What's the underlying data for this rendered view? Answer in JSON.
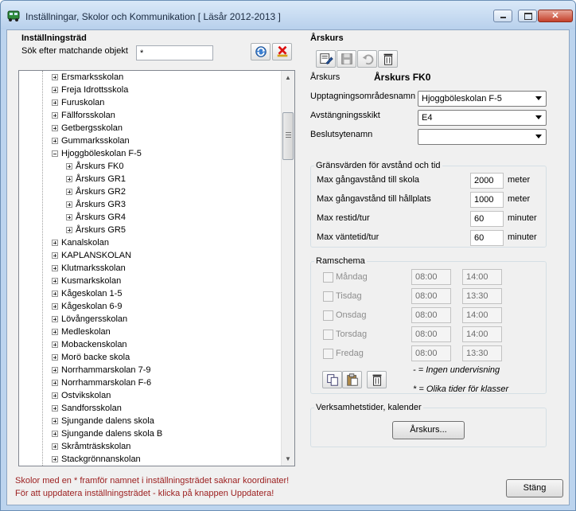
{
  "window": {
    "title": "Inställningar, Skolor och Kommunikation [ Läsår 2012-2013 ]"
  },
  "left": {
    "heading": "Inställningsträd",
    "search_label": "Sök efter matchande objekt",
    "search_value": "*",
    "tree_items": [
      {
        "label": "Ersmarksskolan",
        "level": 0,
        "exp": "plus"
      },
      {
        "label": "Freja Idrottsskola",
        "level": 0,
        "exp": "plus"
      },
      {
        "label": "Furuskolan",
        "level": 0,
        "exp": "plus"
      },
      {
        "label": "Fällforsskolan",
        "level": 0,
        "exp": "plus"
      },
      {
        "label": "Getbergsskolan",
        "level": 0,
        "exp": "plus"
      },
      {
        "label": "Gummarksskolan",
        "level": 0,
        "exp": "plus"
      },
      {
        "label": "Hjoggböleskolan F-5",
        "level": 0,
        "exp": "minus"
      },
      {
        "label": "Årskurs FK0",
        "level": 1,
        "exp": "plus"
      },
      {
        "label": "Årskurs GR1",
        "level": 1,
        "exp": "plus"
      },
      {
        "label": "Årskurs GR2",
        "level": 1,
        "exp": "plus"
      },
      {
        "label": "Årskurs GR3",
        "level": 1,
        "exp": "plus"
      },
      {
        "label": "Årskurs GR4",
        "level": 1,
        "exp": "plus"
      },
      {
        "label": "Årskurs GR5",
        "level": 1,
        "exp": "plus"
      },
      {
        "label": "Kanalskolan",
        "level": 0,
        "exp": "plus"
      },
      {
        "label": "KAPLANSKOLAN",
        "level": 0,
        "exp": "plus"
      },
      {
        "label": "Klutmarksskolan",
        "level": 0,
        "exp": "plus"
      },
      {
        "label": "Kusmarkskolan",
        "level": 0,
        "exp": "plus"
      },
      {
        "label": "Kågeskolan 1-5",
        "level": 0,
        "exp": "plus"
      },
      {
        "label": "Kågeskolan 6-9",
        "level": 0,
        "exp": "plus"
      },
      {
        "label": "Lövångersskolan",
        "level": 0,
        "exp": "plus"
      },
      {
        "label": "Medleskolan",
        "level": 0,
        "exp": "plus"
      },
      {
        "label": "Mobackenskolan",
        "level": 0,
        "exp": "plus"
      },
      {
        "label": "Morö backe skola",
        "level": 0,
        "exp": "plus"
      },
      {
        "label": "Norrhammarskolan 7-9",
        "level": 0,
        "exp": "plus"
      },
      {
        "label": "Norrhammarskolan F-6",
        "level": 0,
        "exp": "plus"
      },
      {
        "label": "Ostvikskolan",
        "level": 0,
        "exp": "plus"
      },
      {
        "label": "Sandforsskolan",
        "level": 0,
        "exp": "plus"
      },
      {
        "label": "Sjungande dalens skola",
        "level": 0,
        "exp": "plus"
      },
      {
        "label": "Sjungande dalens skola B",
        "level": 0,
        "exp": "plus"
      },
      {
        "label": "Skråmträskskolan",
        "level": 0,
        "exp": "plus"
      },
      {
        "label": "Stackgrönnanskolan",
        "level": 0,
        "exp": "plus"
      }
    ]
  },
  "right": {
    "heading": "Årskurs",
    "arskurs_label": "Årskurs",
    "arskurs_value": "Årskurs FK0",
    "upptag_label": "Upptagningsområdesnamn",
    "upptag_value": "Hjoggböleskolan F-5",
    "avst_label": "Avstängningsskikt",
    "avst_value": "E4",
    "beslut_label": "Beslutsytenamn",
    "beslut_value": "",
    "limits": {
      "title": "Gränsvärden för avstånd och tid",
      "rows": [
        {
          "label": "Max gångavstånd till skola",
          "value": "2000",
          "unit": "meter"
        },
        {
          "label": "Max gångavstånd till hållplats",
          "value": "1000",
          "unit": "meter"
        },
        {
          "label": "Max restid/tur",
          "value": "60",
          "unit": "minuter"
        },
        {
          "label": "Max väntetid/tur",
          "value": "60",
          "unit": "minuter"
        }
      ]
    },
    "ramschema": {
      "title": "Ramschema",
      "days": [
        {
          "day": "Måndag",
          "start": "08:00",
          "end": "14:00"
        },
        {
          "day": "Tisdag",
          "start": "08:00",
          "end": "13:30"
        },
        {
          "day": "Onsdag",
          "start": "08:00",
          "end": "14:00"
        },
        {
          "day": "Torsdag",
          "start": "08:00",
          "end": "14:00"
        },
        {
          "day": "Fredag",
          "start": "08:00",
          "end": "13:30"
        }
      ],
      "legend1": "- = Ingen undervisning",
      "legend2": "* = Olika tider för klasser"
    },
    "verksamhet": {
      "title": "Verksamhetstider, kalender",
      "button": "Årskurs..."
    }
  },
  "footer": {
    "note1": "Skolor med en * framför namnet i inställningsträdet saknar koordinater!",
    "note2": "För att uppdatera inställningsträdet - klicka på knappen Uppdatera!",
    "close_button": "Stäng"
  }
}
